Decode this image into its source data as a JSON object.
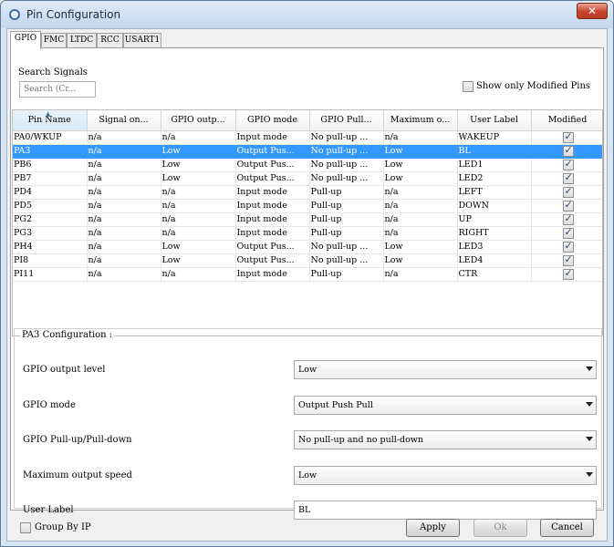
{
  "window": {
    "title": "Pin Configuration",
    "close_label": "✕"
  },
  "tabs": [
    {
      "label": "GPIO",
      "active": true
    },
    {
      "label": "FMC"
    },
    {
      "label": "LTDC"
    },
    {
      "label": "RCC"
    },
    {
      "label": "USART1"
    }
  ],
  "search": {
    "label": "Search Signals",
    "placeholder": "Search (Cr..."
  },
  "show_modified": {
    "label": "Show only Modified Pins",
    "checked": false
  },
  "table": {
    "headers": [
      "Pin Name",
      "Signal on...",
      "GPIO outp...",
      "GPIO mode",
      "GPIO Pull...",
      "Maximum o...",
      "User Label",
      "Modified"
    ],
    "rows": [
      [
        "PA0/WKUP",
        "n/a",
        "n/a",
        "Input mode",
        "No pull-up ...",
        "n/a",
        "WAKEUP"
      ],
      [
        "PA3",
        "n/a",
        "Low",
        "Output Pus...",
        "No pull-up ...",
        "Low",
        "BL"
      ],
      [
        "PB6",
        "n/a",
        "Low",
        "Output Pus...",
        "No pull-up ...",
        "Low",
        "LED1"
      ],
      [
        "PB7",
        "n/a",
        "Low",
        "Output Pus...",
        "No pull-up ...",
        "Low",
        "LED2"
      ],
      [
        "PD4",
        "n/a",
        "n/a",
        "Input mode",
        "Pull-up",
        "n/a",
        "LEFT"
      ],
      [
        "PD5",
        "n/a",
        "n/a",
        "Input mode",
        "Pull-up",
        "n/a",
        "DOWN"
      ],
      [
        "PG2",
        "n/a",
        "n/a",
        "Input mode",
        "Pull-up",
        "n/a",
        "UP"
      ],
      [
        "PG3",
        "n/a",
        "n/a",
        "Input mode",
        "Pull-up",
        "n/a",
        "RIGHT"
      ],
      [
        "PH4",
        "n/a",
        "Low",
        "Output Pus...",
        "No pull-up ...",
        "Low",
        "LED3"
      ],
      [
        "PI8",
        "n/a",
        "Low",
        "Output Pus...",
        "No pull-up ...",
        "Low",
        "LED4"
      ],
      [
        "PI11",
        "n/a",
        "n/a",
        "Input mode",
        "Pull-up",
        "n/a",
        "CTR"
      ]
    ],
    "selected_row": 1
  },
  "config": {
    "title": "PA3 Configuration :",
    "output_level": {
      "label": "GPIO output level",
      "value": "Low"
    },
    "mode": {
      "label": "GPIO mode",
      "value": "Output Push Pull"
    },
    "pull": {
      "label": "GPIO Pull-up/Pull-down",
      "value": "No pull-up and no pull-down"
    },
    "speed": {
      "label": "Maximum output speed",
      "value": "Low"
    },
    "user_label": {
      "label": "User Label",
      "value": "BL"
    }
  },
  "footer": {
    "group_by_ip": "Group By IP",
    "apply": "Apply",
    "ok": "Ok",
    "cancel": "Cancel"
  },
  "colors": {
    "selection": "#3399ff",
    "window_frame": "#d7e4f2"
  }
}
